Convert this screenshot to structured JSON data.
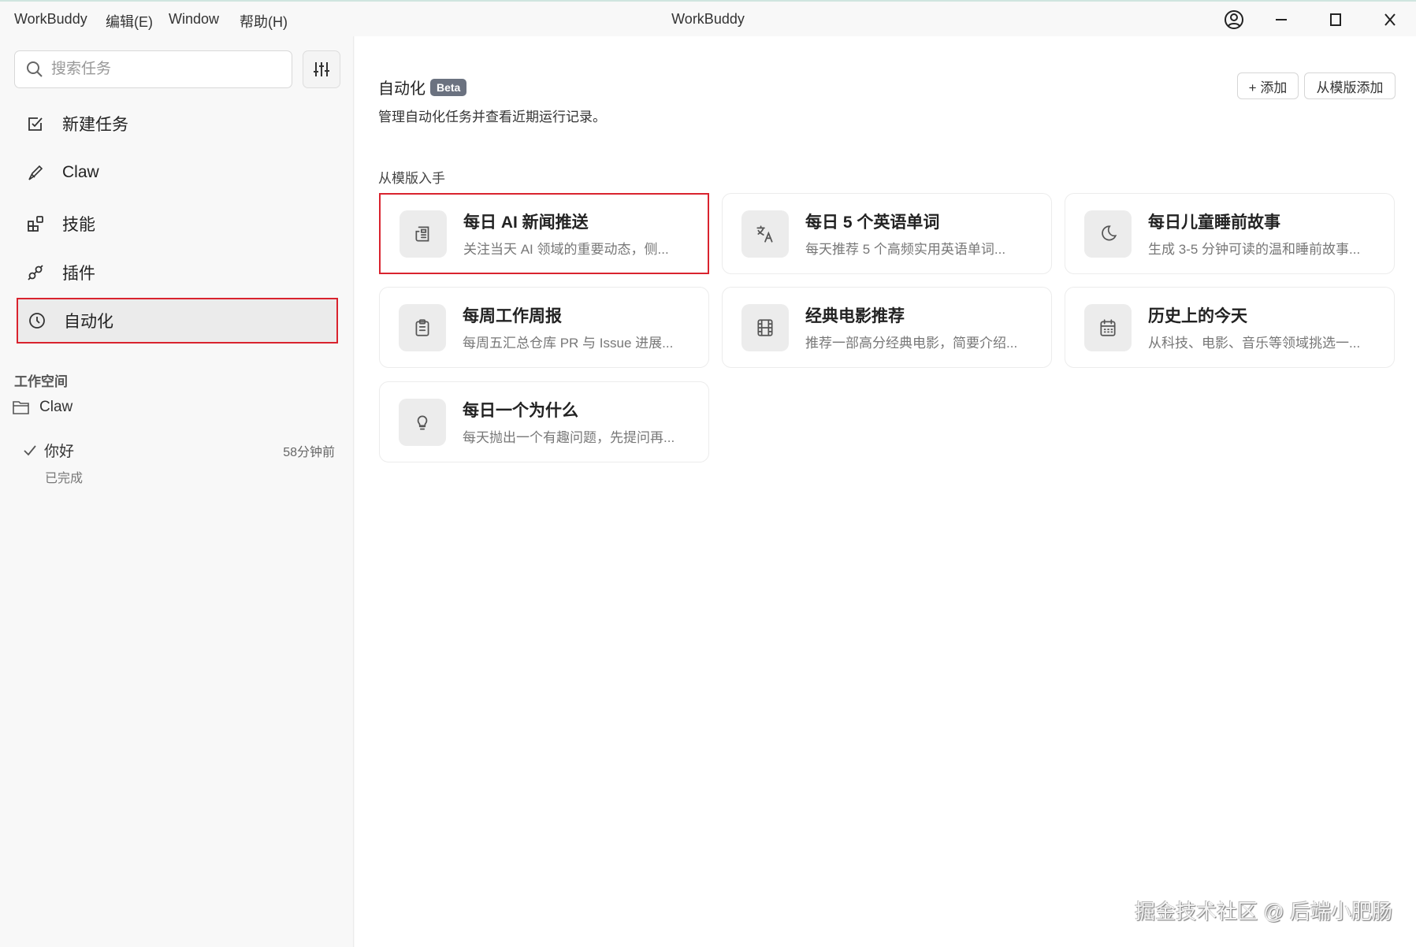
{
  "titlebar": {
    "menus": [
      "WorkBuddy",
      "编辑(E)",
      "Window",
      "帮助(H)"
    ],
    "title": "WorkBuddy"
  },
  "sidebar": {
    "search_placeholder": "搜索任务",
    "nav": [
      {
        "label": "新建任务",
        "icon": "checkbox-edit-icon"
      },
      {
        "label": "Claw",
        "icon": "claw-icon"
      },
      {
        "label": "技能",
        "icon": "skills-grid-icon"
      },
      {
        "label": "插件",
        "icon": "plug-icon"
      },
      {
        "label": "自动化",
        "icon": "clock-icon",
        "active": true
      }
    ],
    "workspace_heading": "工作空间",
    "workspace_folder": "Claw",
    "task": {
      "title": "你好",
      "time": "58分钟前",
      "status": "已完成"
    }
  },
  "main": {
    "title": "自动化",
    "badge": "Beta",
    "subtitle": "管理自动化任务并查看近期运行记录。",
    "add_button": "+ 添加",
    "template_add_button": "从模版添加",
    "section_title": "从模版入手",
    "templates": [
      {
        "title": "每日 AI 新闻推送",
        "desc": "关注当天 AI 领域的重要动态，侧...",
        "icon": "newspaper-icon"
      },
      {
        "title": "每日 5 个英语单词",
        "desc": "每天推荐 5 个高频实用英语单词...",
        "icon": "translate-icon"
      },
      {
        "title": "每日儿童睡前故事",
        "desc": "生成 3-5 分钟可读的温和睡前故事...",
        "icon": "moon-icon"
      },
      {
        "title": "每周工作周报",
        "desc": "每周五汇总仓库 PR 与 Issue 进展...",
        "icon": "clipboard-icon"
      },
      {
        "title": "经典电影推荐",
        "desc": "推荐一部高分经典电影，简要介绍...",
        "icon": "film-icon"
      },
      {
        "title": "历史上的今天",
        "desc": "从科技、电影、音乐等领域挑选一...",
        "icon": "calendar-icon"
      },
      {
        "title": "每日一个为什么",
        "desc": "每天抛出一个有趣问题，先提问再...",
        "icon": "lightbulb-icon"
      }
    ]
  },
  "watermark": "掘金技术社区 @ 后端小肥肠"
}
